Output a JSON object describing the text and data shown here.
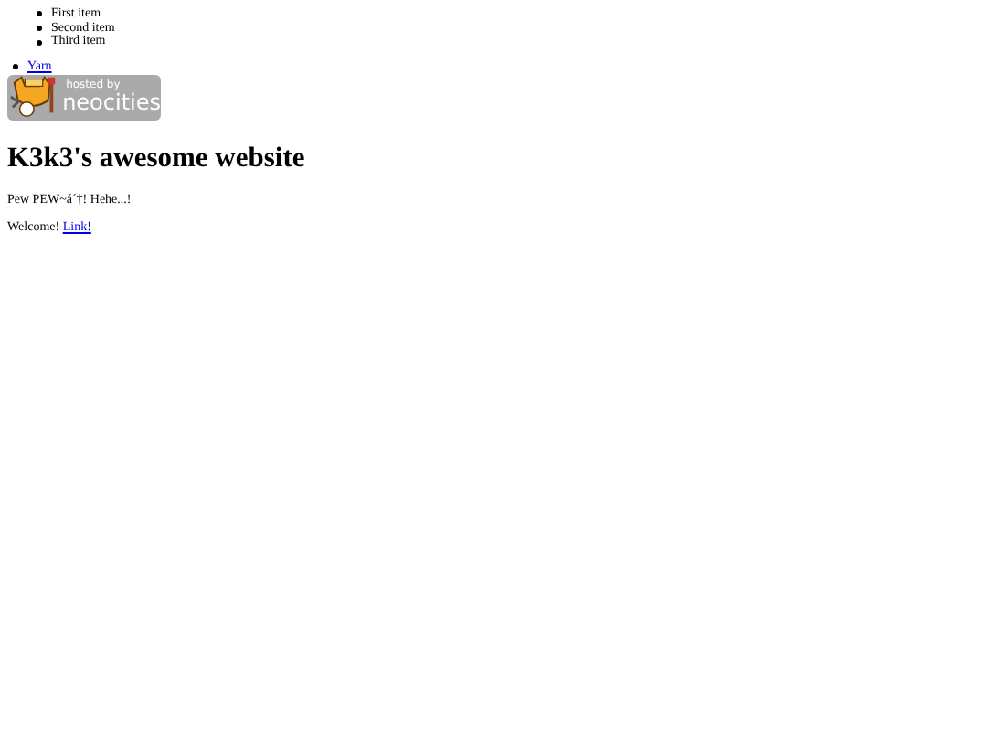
{
  "list": [
    "First item",
    "Second item",
    "Third item"
  ],
  "nav": [
    {
      "label": "Yarn"
    }
  ],
  "badge": {
    "line_1": "hosted by",
    "line_2": "neocities"
  },
  "heading": "K3k3's awesome website",
  "paragraphs": [
    {
      "text": "Pew PEW~á´†! Hehe...!"
    },
    {
      "text": "Welcome!",
      "link": "Link!"
    }
  ]
}
